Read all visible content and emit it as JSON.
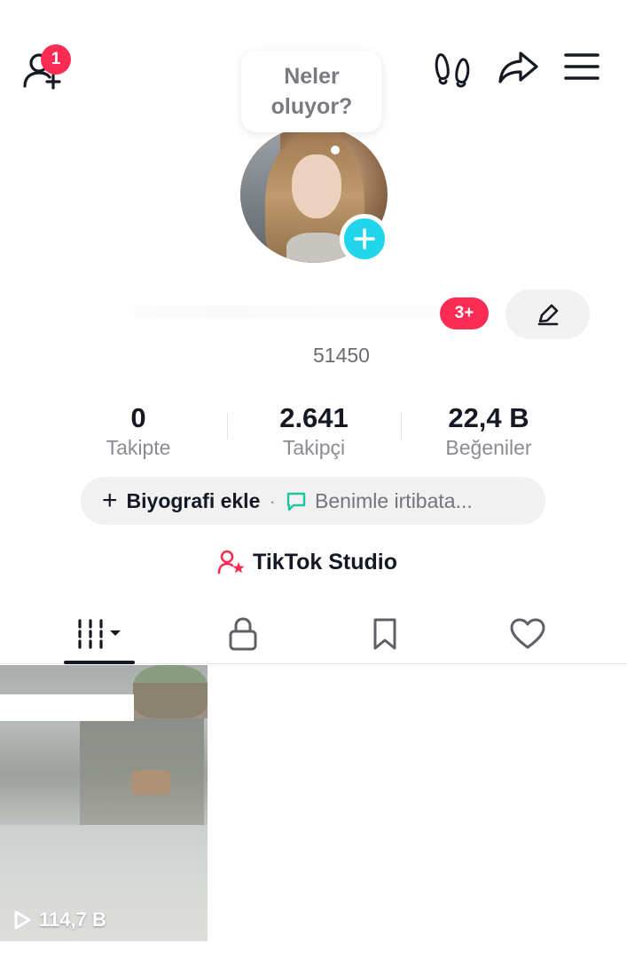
{
  "header": {
    "notification_count": "1",
    "icons": [
      "add-friend-icon",
      "footprints-icon",
      "share-icon",
      "menu-icon"
    ]
  },
  "status_bubble": {
    "text_line1": "Neler",
    "text_line2": "oluyor?"
  },
  "profile": {
    "avatar_badge": "add-story-plus-icon",
    "username": "",
    "badge": "3+",
    "uid": "51450"
  },
  "stats": [
    {
      "value": "0",
      "label": "Takipte"
    },
    {
      "value": "2.641",
      "label": "Takipçi"
    },
    {
      "value": "22,4 B",
      "label": "Beğeniler"
    }
  ],
  "bio": {
    "add_label": "Biyografi ekle",
    "separator": "·",
    "contact_label": "Benimle irtibata..."
  },
  "studio": {
    "label": "TikTok Studio"
  },
  "tabs": [
    {
      "name": "videos",
      "icon": "grid-icon",
      "active": true
    },
    {
      "name": "private",
      "icon": "lock-icon",
      "active": false
    },
    {
      "name": "saved",
      "icon": "bookmark-icon",
      "active": false
    },
    {
      "name": "liked",
      "icon": "heart-icon",
      "active": false
    }
  ],
  "videos": [
    {
      "views": "114,7 B"
    }
  ],
  "colors": {
    "accent_red": "#fe2c55",
    "accent_cyan": "#20d5ec",
    "text_primary": "#161823",
    "text_secondary": "#8a8b91",
    "pill_bg": "#f1f1f2"
  }
}
